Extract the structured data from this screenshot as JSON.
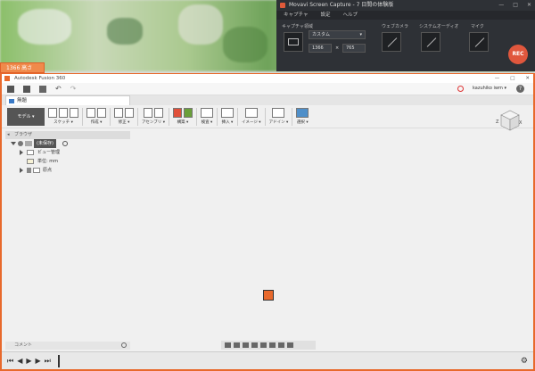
{
  "desktop": {
    "recorder_badge": "1366 高さ 765"
  },
  "capture": {
    "title": "Movavi Screen Capture - 7 日間の体験版",
    "window_buttons": [
      "—",
      "□",
      "✕"
    ],
    "menu": [
      "キャプチャ",
      "設定",
      "ヘルプ"
    ],
    "area_label": "キャプチャ領域",
    "area_select": "カスタム",
    "width": "1366",
    "times": "×",
    "height": "765",
    "webcam_label": "ウェブカメラ",
    "audio_label": "システムオーディオ",
    "mic_label": "マイク",
    "rec_label": "REC"
  },
  "fusion": {
    "title": "Autodesk Fusion 360",
    "window_buttons": [
      "—",
      "□",
      "✕"
    ],
    "user": "kazuhiko iwm ▾",
    "help": "?",
    "doc_tab": "無題",
    "toolbar": {
      "mode": "モデル ▾",
      "groups": [
        {
          "label": "スケッチ ▾",
          "icons": 3
        },
        {
          "label": "作成 ▾",
          "icons": 2
        },
        {
          "label": "修正 ▾",
          "icons": 2
        },
        {
          "label": "アセンブリ ▾",
          "icons": 2
        },
        {
          "label": "構築 ▾",
          "icons": 2
        },
        {
          "label": "検査 ▾",
          "icons": 1
        },
        {
          "label": "挿入 ▾",
          "icons": 1
        },
        {
          "label": "イメージ ▾",
          "icons": 1
        },
        {
          "label": "アドイン ▾",
          "icons": 1
        },
        {
          "label": "選択 ▾",
          "icons": 1
        }
      ]
    },
    "browser": {
      "header": "ブラウザ",
      "root": "(未保存)",
      "items": [
        "ビュー管理",
        "単位: mm",
        "原点"
      ]
    },
    "viewcube_labels": {
      "z": "Z",
      "x": "X"
    },
    "comments_label": "コメント",
    "timeline_controls": [
      "⏮",
      "◀",
      "▶",
      "▶",
      "⏭"
    ],
    "settings_icon": "⚙"
  }
}
